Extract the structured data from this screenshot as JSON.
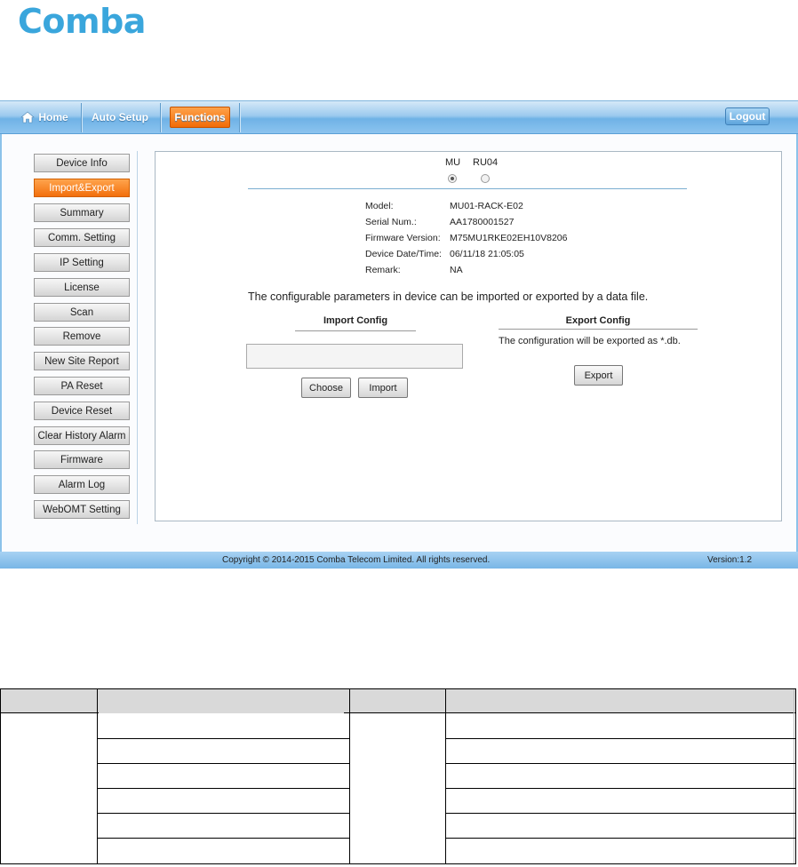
{
  "brand": {
    "logo_text": "Comba",
    "color": "#3aa6dc"
  },
  "nav": {
    "home": "Home",
    "auto_setup": "Auto Setup",
    "functions": "Functions",
    "logout": "Logout"
  },
  "sidebar": {
    "items": [
      "Device Info",
      "Import&Export",
      "Summary",
      "Comm. Setting",
      "IP Setting",
      "License",
      "Scan",
      "Remove",
      "New Site Report",
      "PA Reset",
      "Device Reset",
      "Clear History Alarm",
      "Firmware",
      "Alarm Log",
      "WebOMT Setting"
    ],
    "active_index": 1
  },
  "device_select": {
    "options": [
      "MU",
      "RU04"
    ],
    "selected": "MU"
  },
  "device_info": {
    "model_label": "Model:",
    "model": "MU01-RACK-E02",
    "serial_label": "Serial Num.:",
    "serial": "AA1780001527",
    "firmware_label": "Firmware Version:",
    "firmware": "M75MU1RKE02EH10V8206",
    "datetime_label": "Device Date/Time:",
    "datetime": "06/11/18 21:05:05",
    "remark_label": "Remark:",
    "remark": "NA"
  },
  "description": "The configurable parameters in device can be imported or exported by a data file.",
  "import": {
    "title": "Import Config",
    "choose": "Choose",
    "import": "Import"
  },
  "export": {
    "title": "Export Config",
    "text": "The configuration will be exported as *.db.",
    "button": "Export"
  },
  "footer": {
    "copyright": "Copyright © 2014-2015 Comba Telecom Limited. All rights reserved.",
    "version": "Version:1.2"
  },
  "colors": {
    "accent_orange": "#f26f0c",
    "nav_blue": "#6fb2e6"
  }
}
